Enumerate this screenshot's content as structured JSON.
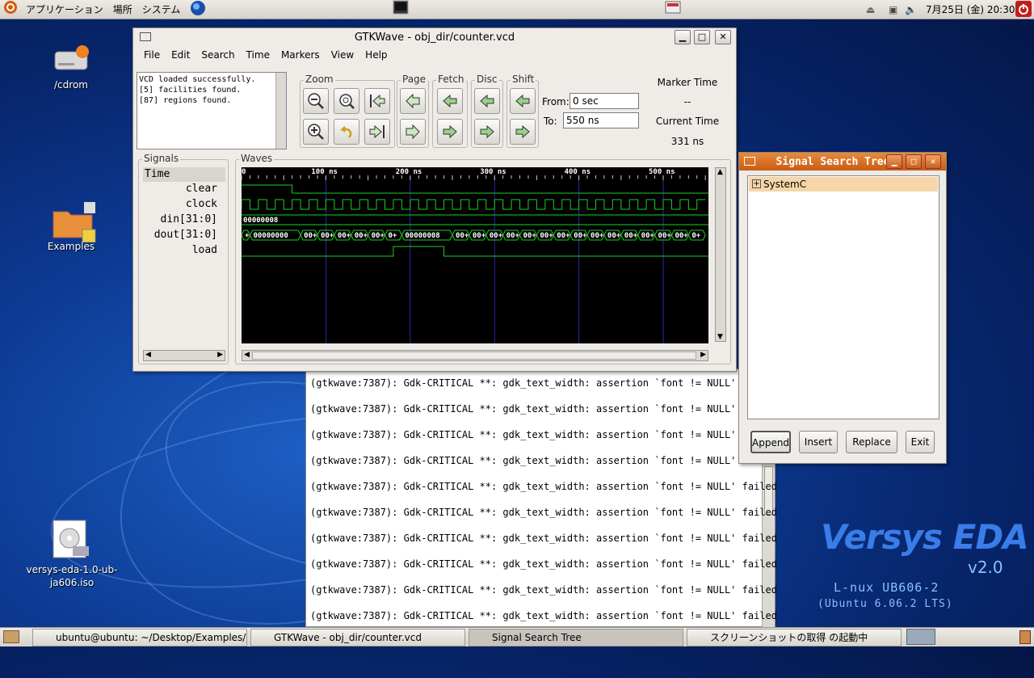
{
  "top_panel": {
    "applications": "アプリケーション",
    "places": "場所",
    "system": "システム",
    "clock": "7月25日 (金) 20:30"
  },
  "desktop": {
    "cdrom": "/cdrom",
    "examples": "Examples",
    "iso_line1": "versys-eda-1.0-ub-",
    "iso_line2": "ja606.iso"
  },
  "brand": {
    "name": "Versys EDA",
    "version": "v2.0",
    "os": "L-nux UB606-2",
    "os_full": "(Ubuntu 6.06.2 LTS)"
  },
  "gtkwave": {
    "title": "GTKWave - obj_dir/counter.vcd",
    "menu": [
      "File",
      "Edit",
      "Search",
      "Time",
      "Markers",
      "View",
      "Help"
    ],
    "log": [
      "VCD loaded successfully.",
      "[5] facilities found.",
      "[87] regions found."
    ],
    "groups": {
      "zoom": "Zoom",
      "page": "Page",
      "fetch": "Fetch",
      "disc": "Disc",
      "shift": "Shift"
    },
    "from_label": "From:",
    "from_value": "0 sec",
    "to_label": "To:",
    "to_value": "550 ns",
    "marker_time_label": "Marker Time",
    "marker_time_value": "--",
    "current_time_label": "Current Time",
    "current_time_value": "331 ns",
    "signals_label": "Signals",
    "waves_label": "Waves",
    "signals": [
      "Time",
      "clear",
      "clock",
      "din[31:0]",
      "dout[31:0]",
      "load"
    ],
    "time_ticks": [
      "0",
      "100 ns",
      "200 ns",
      "300 ns",
      "400 ns",
      "500 ns"
    ],
    "din_value": "00000008",
    "dout_value1": "00000000",
    "dout_value2": "00000008",
    "dout_short": "00+",
    "dout_plus": "+",
    "dout_zero_plus": "0+"
  },
  "terminal": {
    "lines": [
      "(gtkwave:7387): Gdk-CRITICAL **: gdk_text_width: assertion `font != NULL' fa",
      "(gtkwave:7387): Gdk-CRITICAL **: gdk_text_width: assertion `font != NULL' fa",
      "(gtkwave:7387): Gdk-CRITICAL **: gdk_text_width: assertion `font != NULL' fa",
      "(gtkwave:7387): Gdk-CRITICAL **: gdk_text_width: assertion `font != NULL' fa",
      "(gtkwave:7387): Gdk-CRITICAL **: gdk_text_width: assertion `font != NULL' failed",
      "(gtkwave:7387): Gdk-CRITICAL **: gdk_text_width: assertion `font != NULL' failed",
      "(gtkwave:7387): Gdk-CRITICAL **: gdk_text_width: assertion `font != NULL' failed",
      "(gtkwave:7387): Gdk-CRITICAL **: gdk_text_width: assertion `font != NULL' failed",
      "(gtkwave:7387): Gdk-CRITICAL **: gdk_text_width: assertion `font != NULL' failed",
      "(gtkwave:7387): Gdk-CRITICAL **: gdk_text_width: assertion `font != NULL' failed"
    ]
  },
  "search_tree": {
    "title": "Signal Search Tree",
    "root": "SystemC",
    "append": "Append",
    "insert": "Insert",
    "replace": "Replace",
    "exit": "Exit"
  },
  "taskbar": {
    "items": [
      "ubuntu@ubuntu: ~/Desktop/Examples/…",
      "GTKWave - obj_dir/counter.vcd",
      "Signal Search Tree",
      "スクリーンショットの取得 の起動中"
    ]
  }
}
